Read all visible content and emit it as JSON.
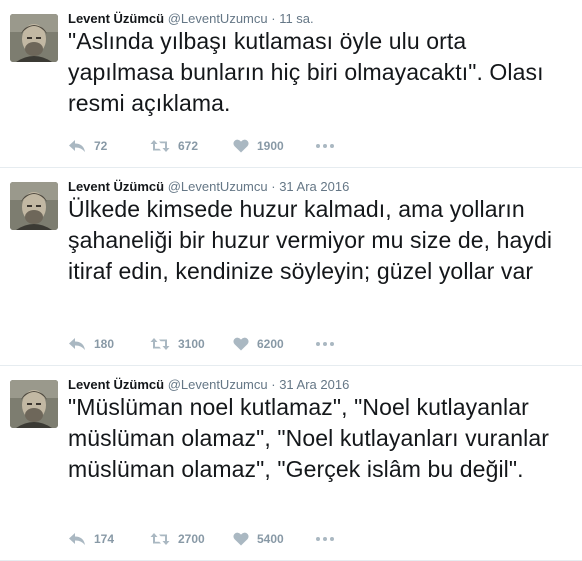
{
  "tweets": [
    {
      "author_name": "Levent Üzümcü",
      "handle": "@LeventUzumcu",
      "separator": "·",
      "time": "11 sa.",
      "text": "\"Aslında yılbaşı kutlaması öyle ulu orta yapılmasa bunların hiç biri olmayacaktı\". Olası resmi açıklama.",
      "replies": "72",
      "retweets": "672",
      "likes": "1900"
    },
    {
      "author_name": "Levent Üzümcü",
      "handle": "@LeventUzumcu",
      "separator": "·",
      "time": "31 Ara 2016",
      "text": "Ülkede kimsede huzur kalmadı, ama yolların şahaneliği bir huzur vermiyor mu size de, haydi itiraf edin, kendinize söyleyin; güzel yollar var",
      "replies": "180",
      "retweets": "3100",
      "likes": "6200"
    },
    {
      "author_name": "Levent Üzümcü",
      "handle": "@LeventUzumcu",
      "separator": "·",
      "time": "31 Ara 2016",
      "text": "\"Müslüman noel kutlamaz\", \"Noel kutlayanlar müslüman olamaz\", \"Noel kutlayanları vuranlar müslüman olamaz\", \"Gerçek islâm bu değil\".",
      "replies": "174",
      "retweets": "2700",
      "likes": "5400"
    }
  ],
  "icons": {
    "reply": "reply-icon",
    "retweet": "retweet-icon",
    "like": "heart-icon",
    "more": "more-icon",
    "avatar": "avatar"
  },
  "colors": {
    "text": "#14171a",
    "muted": "#657786",
    "action": "#aab8c2",
    "divider": "#e6ecf0"
  }
}
